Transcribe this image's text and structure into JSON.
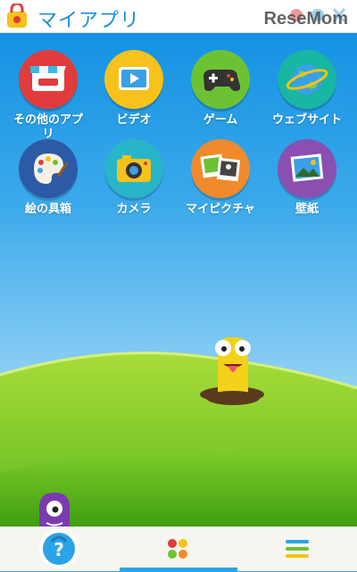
{
  "header": {
    "title": "マイアプリ",
    "watermark": "ReseMom"
  },
  "apps": [
    {
      "label_line1": "その他のアプ",
      "label_line2": "リ",
      "icon": "store-icon",
      "color": "#e23b3b"
    },
    {
      "label_line1": "ビデオ",
      "label_line2": "",
      "icon": "video-play-icon",
      "color": "#f6c21b"
    },
    {
      "label_line1": "ゲーム",
      "label_line2": "",
      "icon": "gamepad-icon",
      "color": "#6cc233"
    },
    {
      "label_line1": "ウェブサイト",
      "label_line2": "",
      "icon": "globe-icon",
      "color": "#17b7a3"
    },
    {
      "label_line1": "絵の具箱",
      "label_line2": "",
      "icon": "palette-icon",
      "color": "#2d5aa6"
    },
    {
      "label_line1": "カメラ",
      "label_line2": "",
      "icon": "camera-icon",
      "color": "#28b5c9"
    },
    {
      "label_line1": "マイピクチャ",
      "label_line2": "",
      "icon": "photos-icon",
      "color": "#f08a2c"
    },
    {
      "label_line1": "壁紙",
      "label_line2": "",
      "icon": "wallpaper-icon",
      "color": "#8a4fb1"
    }
  ],
  "bottom_nav": {
    "help_label": "?",
    "items": [
      "help-icon",
      "apps-dots-icon",
      "menu-lines-icon"
    ]
  }
}
